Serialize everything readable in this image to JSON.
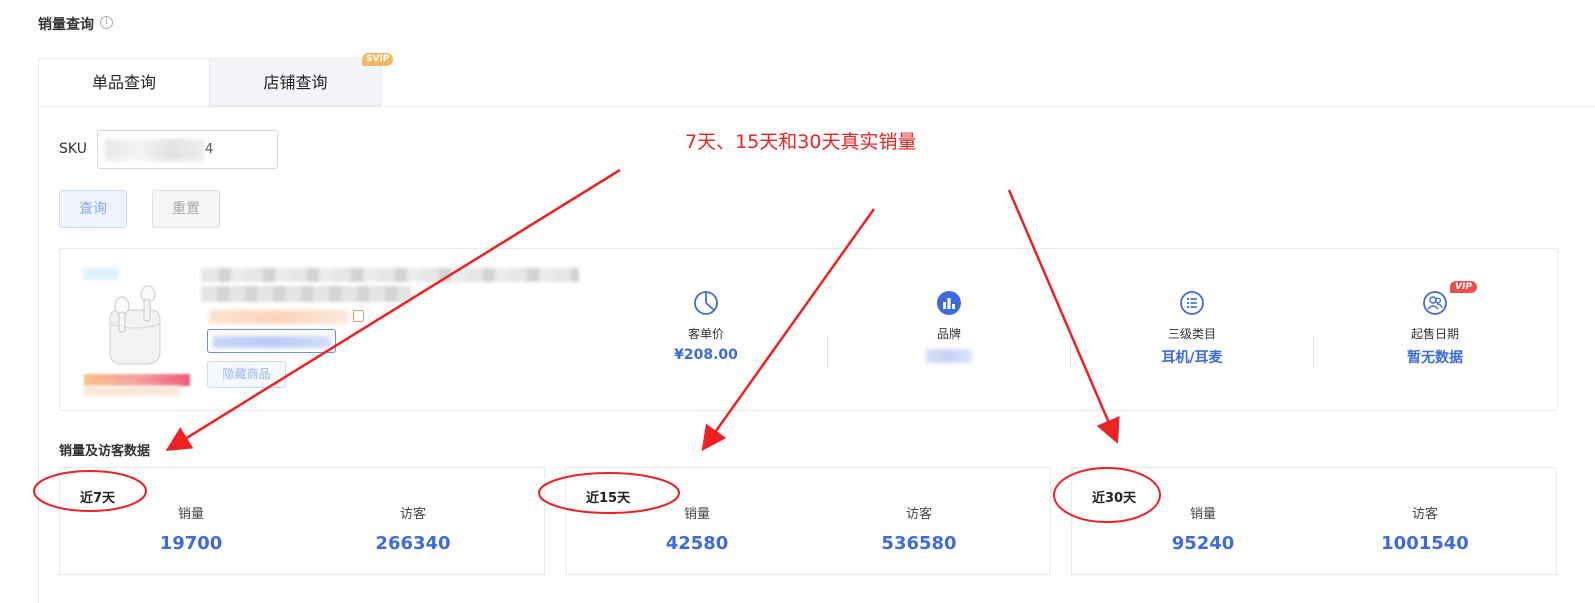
{
  "page": {
    "title": "销量查询",
    "info_icon": "i"
  },
  "tabs": [
    {
      "label": "单品查询",
      "active": true
    },
    {
      "label": "店铺查询",
      "active": false,
      "badge": "SVIP"
    }
  ],
  "search": {
    "label": "SKU",
    "value_suffix": "4",
    "query_button": "查询",
    "reset_button": "重置"
  },
  "product": {
    "hide_button": "隐藏商品",
    "stats": [
      {
        "label": "客单价",
        "value": "¥208.00",
        "icon": "pie-chart-icon"
      },
      {
        "label": "品牌",
        "value": "",
        "icon": "bar-chart-icon"
      },
      {
        "label": "三级类目",
        "value": "耳机/耳麦",
        "icon": "list-icon"
      },
      {
        "label": "起售日期",
        "value": "暂无数据",
        "icon": "users-icon",
        "badge": "VIP"
      }
    ]
  },
  "sales": {
    "section_title": "销量及访客数据",
    "periods": [
      {
        "label": "近7天",
        "sales_label": "销量",
        "sales": "19700",
        "visitors_label": "访客",
        "visitors": "266340"
      },
      {
        "label": "近15天",
        "sales_label": "销量",
        "sales": "42580",
        "visitors_label": "访客",
        "visitors": "536580"
      },
      {
        "label": "近30天",
        "sales_label": "销量",
        "sales": "95240",
        "visitors_label": "访客",
        "visitors": "1001540"
      }
    ]
  },
  "annotation": {
    "text": "7天、15天和30天真实销量",
    "color": "#ee2222"
  },
  "colors": {
    "accent": "#3d6bdf",
    "annotation": "#ee2222",
    "svip_badge": "#f3b664",
    "vip_badge": "#f04d4d"
  }
}
